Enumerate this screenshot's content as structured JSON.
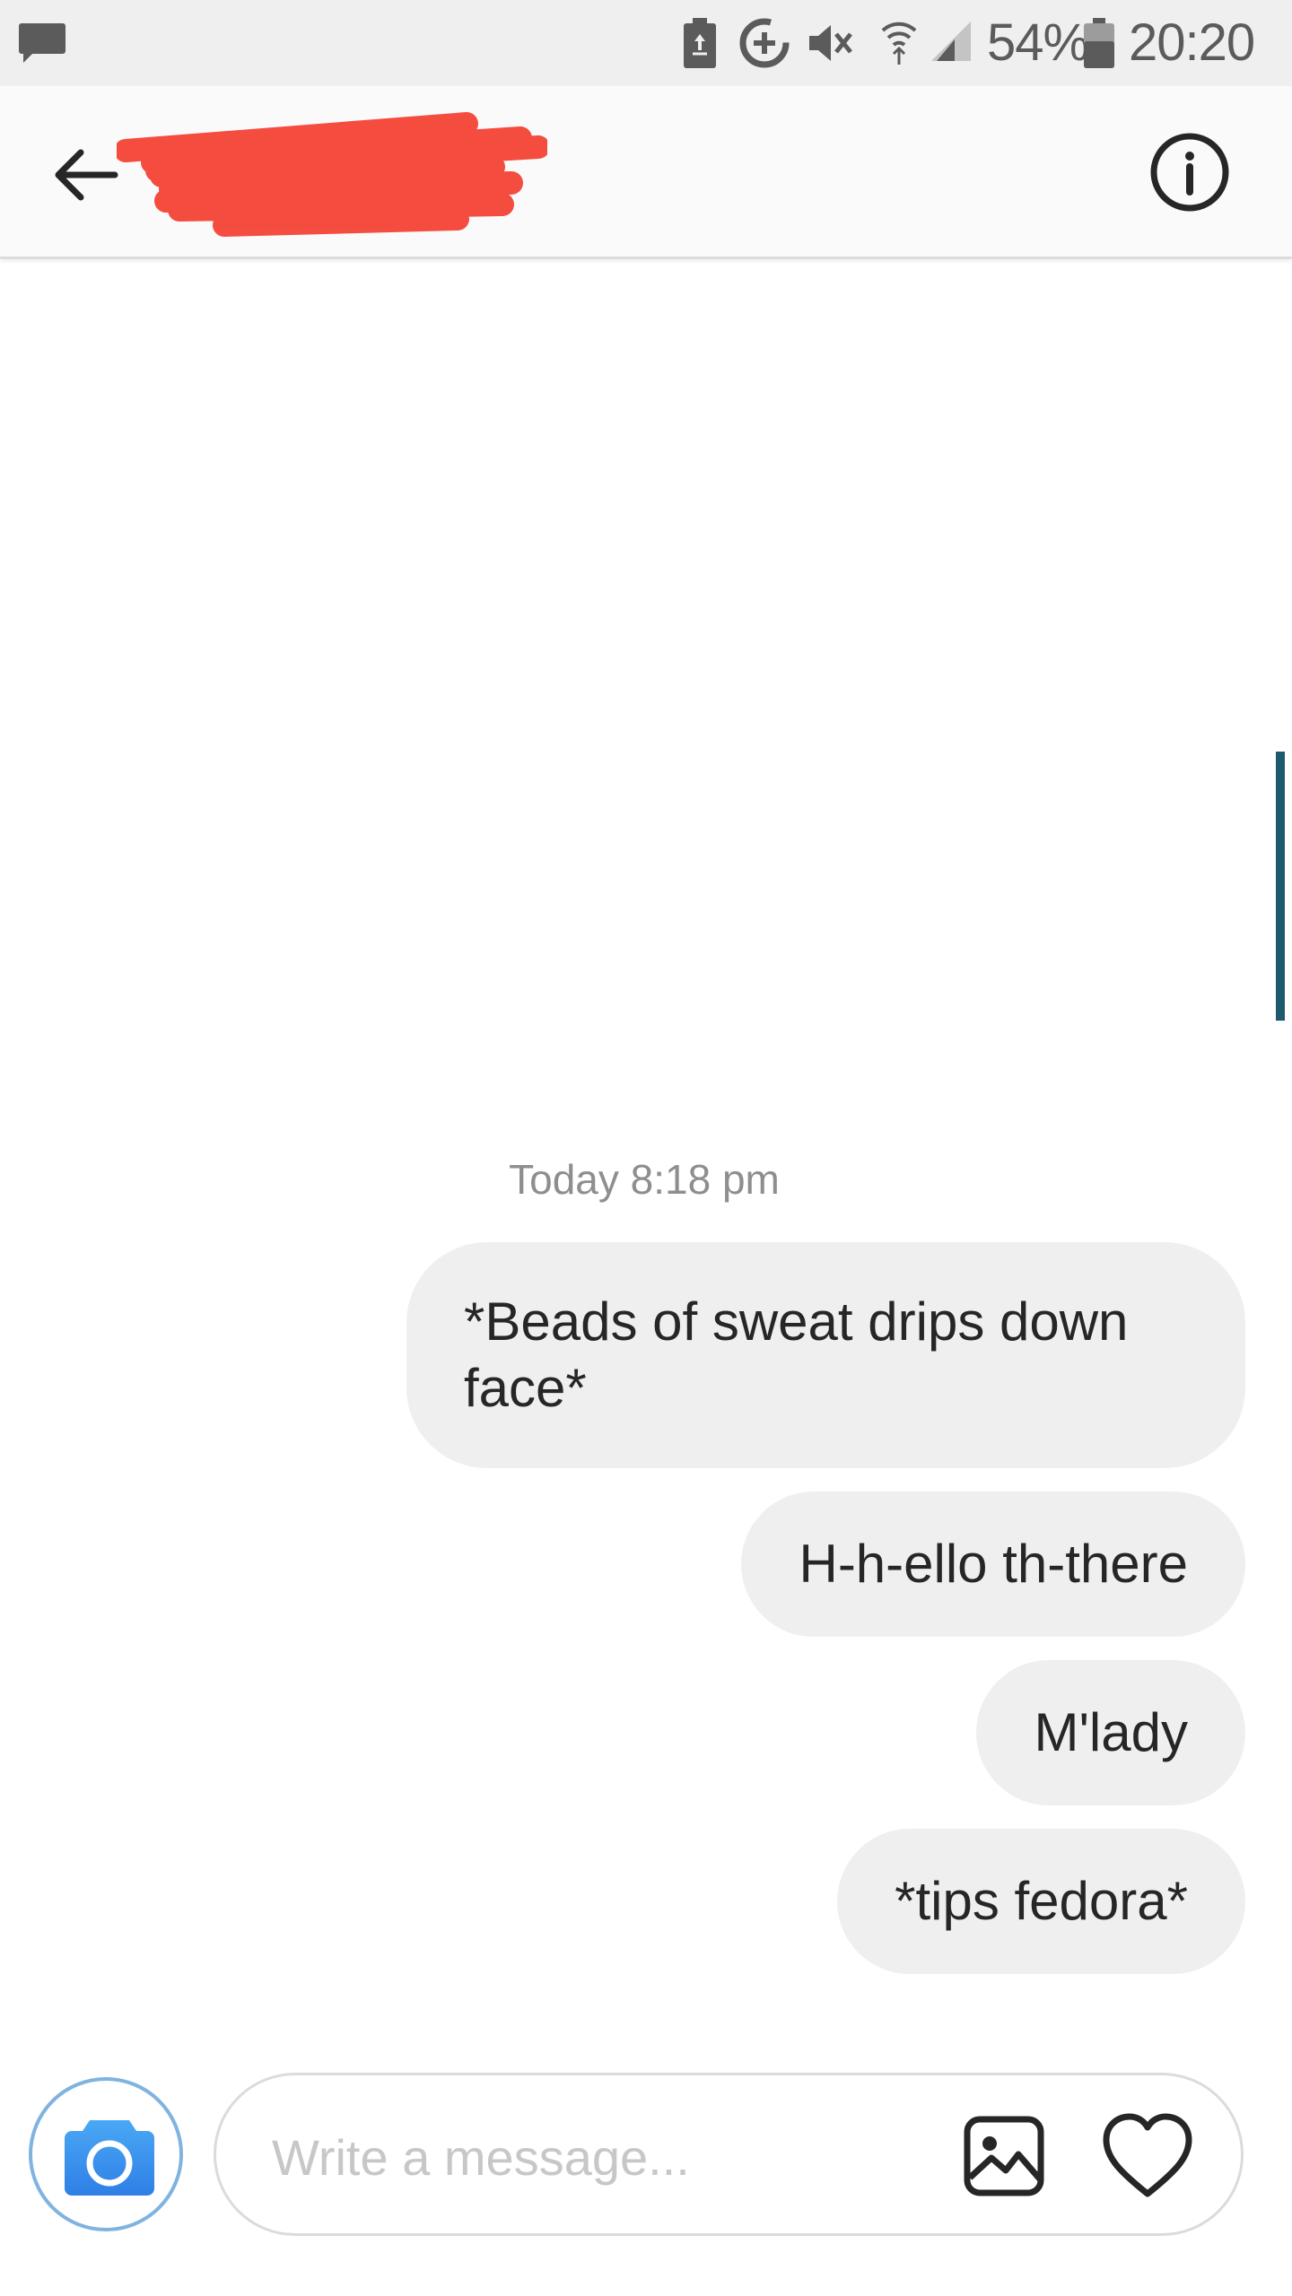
{
  "status_bar": {
    "battery": "54%",
    "time": "20:20",
    "icons": [
      "message-notification-icon",
      "battery-saver-icon",
      "data-saver-icon",
      "mute-icon",
      "wifi-icon",
      "signal-icon",
      "battery-icon"
    ]
  },
  "header": {
    "back_icon": "back-arrow-icon",
    "info_icon": "info-icon",
    "contact_name_redacted": true
  },
  "thread": {
    "timestamp": "Today 8:18 pm",
    "messages": [
      {
        "text": "*Beads of sweat drips down face*",
        "from": "me"
      },
      {
        "text": "H-h-ello th-there",
        "from": "me"
      },
      {
        "text": "M'lady",
        "from": "me"
      },
      {
        "text": "*tips fedora*",
        "from": "me"
      }
    ]
  },
  "composer": {
    "placeholder": "Write a message...",
    "value": "",
    "camera_icon": "camera-icon",
    "gallery_icon": "gallery-icon",
    "like_icon": "heart-icon"
  },
  "colors": {
    "status_bar_bg": "#efeff0",
    "bubble_bg": "#efefef",
    "camera_blue": "#3897f0",
    "redaction": "#f44336"
  }
}
